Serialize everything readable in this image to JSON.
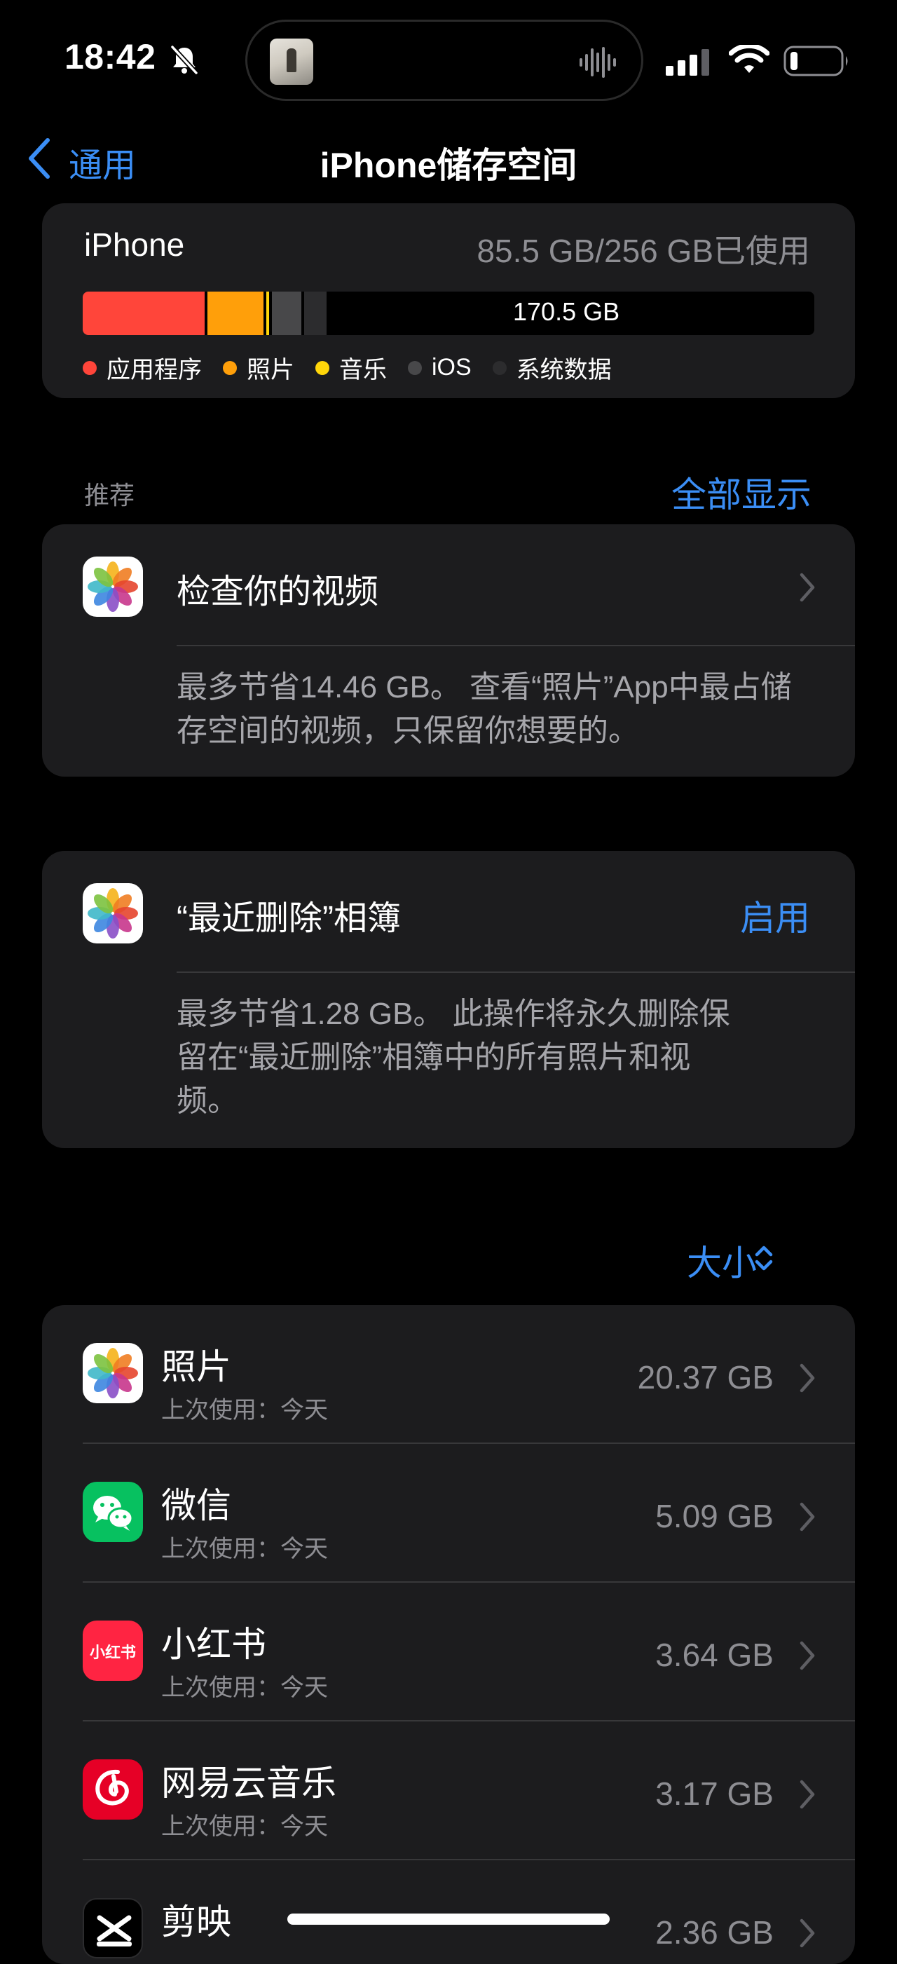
{
  "status_bar": {
    "time": "18:42"
  },
  "nav": {
    "back_label": "通用",
    "title": "iPhone储存空间"
  },
  "storage": {
    "device_name": "iPhone",
    "usage_text": "85.5 GB/256 GB已使用",
    "free_label": "170.5 GB",
    "legend": [
      {
        "label": "应用程序",
        "color": "#ff453a"
      },
      {
        "label": "照片",
        "color": "#ff9f0a"
      },
      {
        "label": "音乐",
        "color": "#ffd60a"
      },
      {
        "label": "iOS",
        "color": "#48484a"
      },
      {
        "label": "系统数据",
        "color": "#2c2c2e"
      }
    ]
  },
  "recommendations": {
    "section_label": "推荐",
    "show_all": "全部显示",
    "items": [
      {
        "title": "检查你的视频",
        "description": "最多节省14.46 GB。 查看“照片”App中最占储存空间的视频，只保留你想要的。"
      },
      {
        "title": "“最近删除”相簿",
        "action": "启用",
        "description": "最多节省1.28 GB。 此操作将永久删除保留在“最近删除”相簿中的所有照片和视频。"
      }
    ]
  },
  "sort": {
    "label": "大小"
  },
  "apps": [
    {
      "name": "照片",
      "last_used": "上次使用：今天",
      "size": "20.37 GB",
      "icon": "photos-icon"
    },
    {
      "name": "微信",
      "last_used": "上次使用：今天",
      "size": "5.09 GB",
      "icon": "wechat-icon"
    },
    {
      "name": "小红书",
      "last_used": "上次使用：今天",
      "size": "3.64 GB",
      "icon": "xiaohongshu-icon",
      "icon_text": "小红书"
    },
    {
      "name": "网易云音乐",
      "last_used": "上次使用：今天",
      "size": "3.17 GB",
      "icon": "netease-music-icon"
    },
    {
      "name": "剪映",
      "last_used": "",
      "size": "2.36 GB",
      "icon": "capcut-icon"
    }
  ],
  "colors": {
    "accent": "#3b8ef5",
    "card_bg": "#1c1c1e",
    "secondary_text": "#8e8e93"
  }
}
